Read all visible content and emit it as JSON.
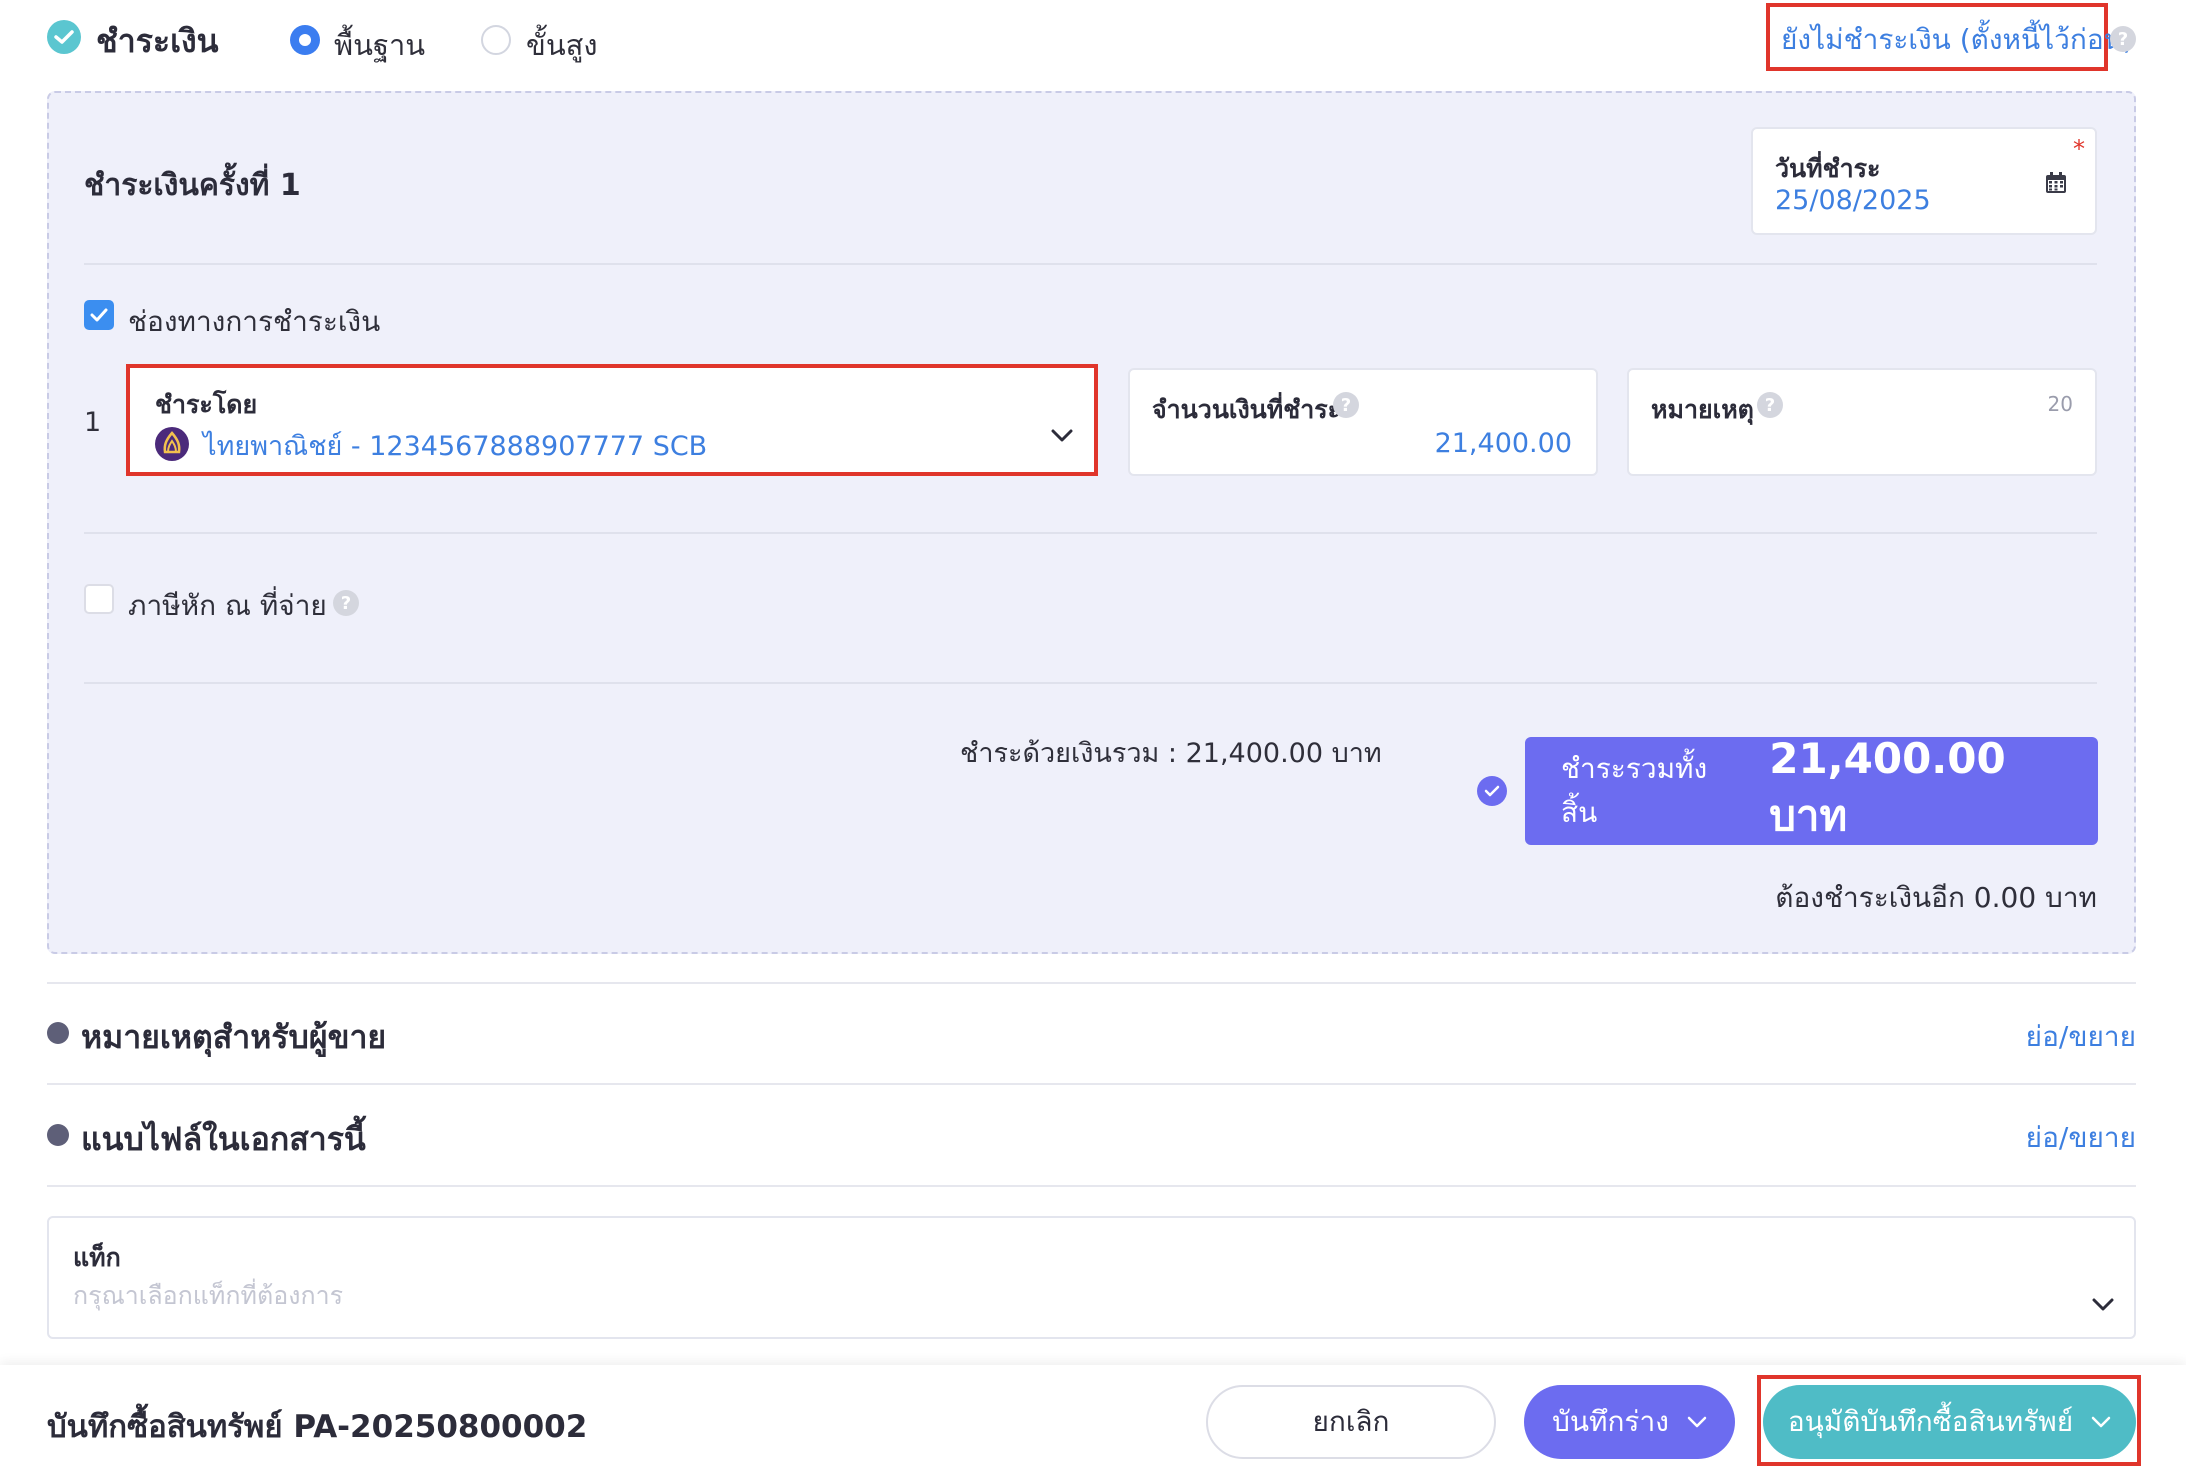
{
  "payment_header": {
    "title": "ชำระเงิน",
    "mode_basic": "พื้นฐาน",
    "mode_advanced": "ขั้นสูง",
    "unpaid_link": "ยังไม่ชำระเงิน (ตั้งหนี้ไว้ก่อน)",
    "help": "?"
  },
  "installment": {
    "title": "ชำระเงินครั้งที่ 1",
    "date_label": "วันที่ชำระ",
    "date_value": "25/08/2025",
    "required_mark": "*"
  },
  "channel": {
    "checkbox_label": "ช่องทางการชำระเงิน",
    "row_index": "1",
    "pay_by_label": "ชำระโดย",
    "pay_by_value": "ไทยพาณิชย์ - 1234567888907777 SCB",
    "amount_label": "จำนวนเงินที่ชำระ",
    "amount_value": "21,400.00",
    "note_label": "หมายเหตุ",
    "note_counter": "20"
  },
  "withholding": {
    "label": "ภาษีหัก ณ ที่จ่าย"
  },
  "summary": {
    "cash_total": "ชำระด้วยเงินรวม :  21,400.00 บาท",
    "grand_total_label": "ชำระรวมทั้งสิ้น",
    "grand_total_value": "21,400.00 บาท",
    "remaining": "ต้องชำระเงินอีก 0.00 บาท"
  },
  "sections": {
    "seller_note_title": "หมายเหตุสำหรับผู้ขาย",
    "seller_note_toggle": "ย่อ/ขยาย",
    "attachments_title": "แนบไฟล์ในเอกสารนี้",
    "attachments_toggle": "ย่อ/ขยาย"
  },
  "tags": {
    "label": "แท็ก",
    "placeholder": "กรุณาเลือกแท็กที่ต้องการ"
  },
  "footer": {
    "doc_title": "บันทึกซื้อสินทรัพย์ PA-20250800002",
    "cancel": "ยกเลิก",
    "save_draft": "บันทึกร่าง",
    "approve": "อนุมัติบันทึกซื้อสินทรัพย์"
  },
  "colors": {
    "accent": "#3d7fe0",
    "primary_button": "#6c6cf0",
    "approve_button": "#4fbcc6",
    "highlight": "#e0352b"
  }
}
